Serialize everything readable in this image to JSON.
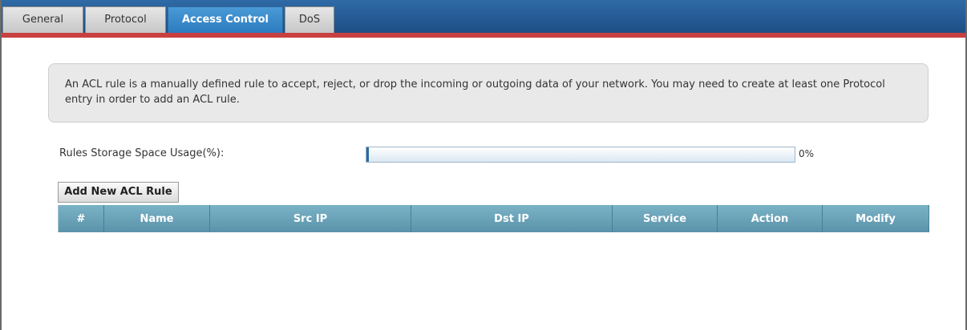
{
  "tabs": [
    {
      "label": "General",
      "active": false
    },
    {
      "label": "Protocol",
      "active": false
    },
    {
      "label": "Access Control",
      "active": true
    },
    {
      "label": "DoS",
      "active": false
    }
  ],
  "info": {
    "text": "An ACL rule is a manually defined rule to accept, reject, or drop the incoming or outgoing data of your network. You may need to create at least one Protocol entry in order to add an ACL rule."
  },
  "storage": {
    "label": "Rules Storage Space Usage(%):",
    "value_text": "0%",
    "usage_percent": 0
  },
  "add_button": {
    "label": "Add New ACL Rule"
  },
  "table": {
    "columns": [
      "#",
      "Name",
      "Src IP",
      "Dst IP",
      "Service",
      "Action",
      "Modify"
    ],
    "rows": []
  },
  "colors": {
    "tabbar_blue": "#1e4f85",
    "accent_red": "#c94040",
    "active_tab": "#2c7cc0",
    "table_header": "#6aa2b8"
  }
}
